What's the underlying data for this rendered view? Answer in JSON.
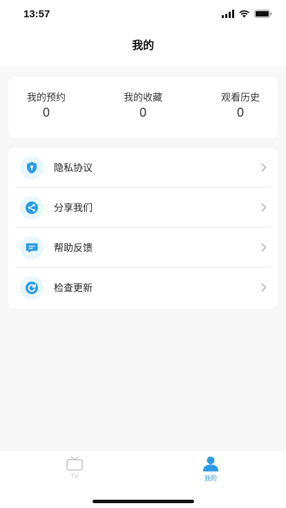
{
  "status_bar": {
    "time": "13:57"
  },
  "header": {
    "title": "我的"
  },
  "stats": [
    {
      "label": "我的预约",
      "value": "0"
    },
    {
      "label": "我的收藏",
      "value": "0"
    },
    {
      "label": "观看历史",
      "value": "0"
    }
  ],
  "menu": [
    {
      "label": "隐私协议",
      "icon": "shield-icon"
    },
    {
      "label": "分享我们",
      "icon": "share-icon"
    },
    {
      "label": "帮助反馈",
      "icon": "feedback-icon"
    },
    {
      "label": "检查更新",
      "icon": "refresh-icon"
    }
  ],
  "tabs": [
    {
      "label": "TV",
      "icon": "tv-icon",
      "active": false
    },
    {
      "label": "我的",
      "icon": "user-icon",
      "active": true
    }
  ],
  "colors": {
    "accent": "#2b9be6",
    "icon_bg": "#e8f7fd",
    "inactive_tab": "#c8c8c8"
  }
}
